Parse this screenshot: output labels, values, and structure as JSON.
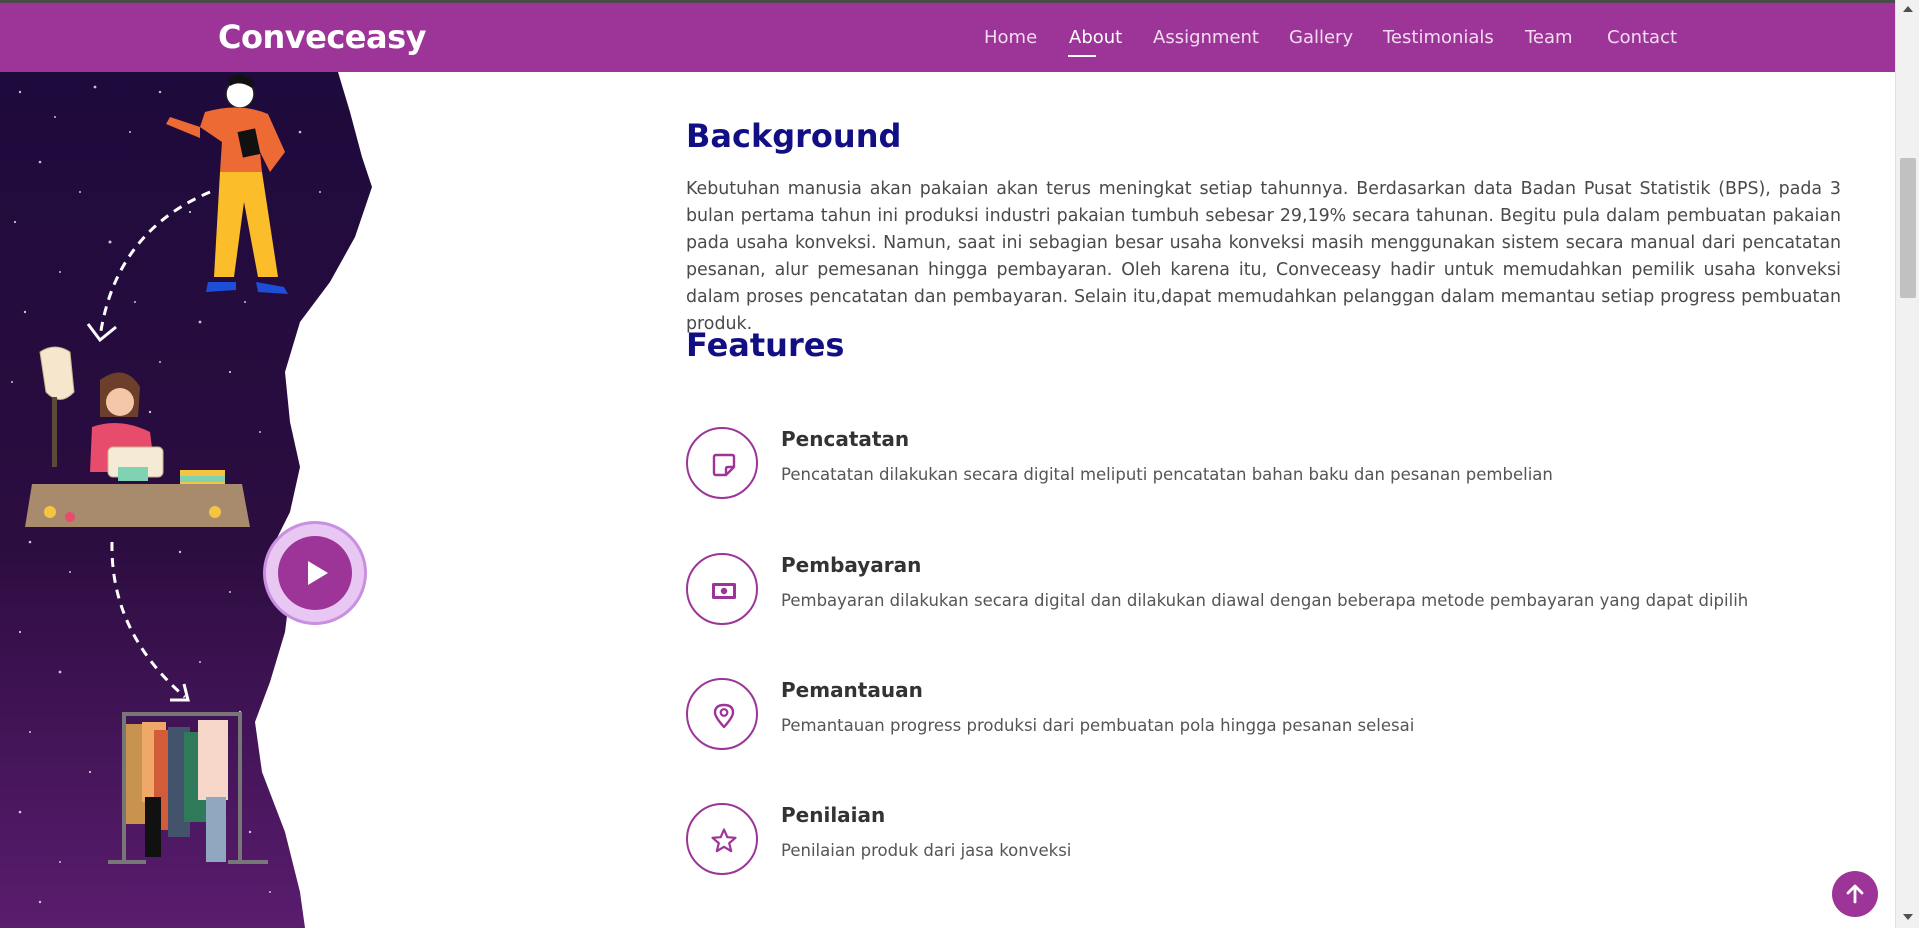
{
  "header": {
    "brand": "Conveceasy",
    "nav": [
      {
        "label": "Home",
        "active": false
      },
      {
        "label": "About",
        "active": true
      },
      {
        "label": "Assignment",
        "active": false
      },
      {
        "label": "Gallery",
        "active": false
      },
      {
        "label": "Testimonials",
        "active": false
      },
      {
        "label": "Team",
        "active": false
      },
      {
        "label": "Contact",
        "active": false
      }
    ]
  },
  "about": {
    "background_title": "Background",
    "background_text": "Kebutuhan manusia akan pakaian akan terus meningkat setiap tahunnya. Berdasarkan data Badan Pusat Statistik (BPS), pada 3 bulan pertama tahun ini produksi industri pakaian tumbuh sebesar 29,19% secara tahunan. Begitu pula dalam pembuatan pakaian pada usaha konveksi. Namun, saat ini sebagian besar usaha konveksi masih menggunakan sistem secara manual dari pencatatan pesanan, alur pemesanan hingga pembayaran. Oleh karena itu, Conveceasy hadir untuk memudahkan pemilik usaha konveksi dalam proses pencatatan dan pembayaran. Selain itu,dapat memudahkan pelanggan dalam memantau setiap progress pembuatan produk.",
    "features_title": "Features",
    "features": [
      {
        "icon": "sticky-note-icon",
        "title": "Pencatatan",
        "desc": "Pencatatan dilakukan secara digital meliputi pencatatan bahan baku dan pesanan pembelian"
      },
      {
        "icon": "cash-icon",
        "title": "Pembayaran",
        "desc": "Pembayaran dilakukan secara digital dan dilakukan diawal dengan beberapa metode pembayaran yang dapat dipilih"
      },
      {
        "icon": "location-pin-icon",
        "title": "Pemantauan",
        "desc": "Pemantauan progress produksi dari pembuatan pola hingga pesanan selesai"
      },
      {
        "icon": "star-icon",
        "title": "Penilaian",
        "desc": "Penilaian produk dari jasa konveksi"
      }
    ]
  },
  "colors": {
    "brand": "#9c3597",
    "heading": "#120f85",
    "hero_dark": "#1e0a3c",
    "hero_light": "#5a1c6e"
  }
}
